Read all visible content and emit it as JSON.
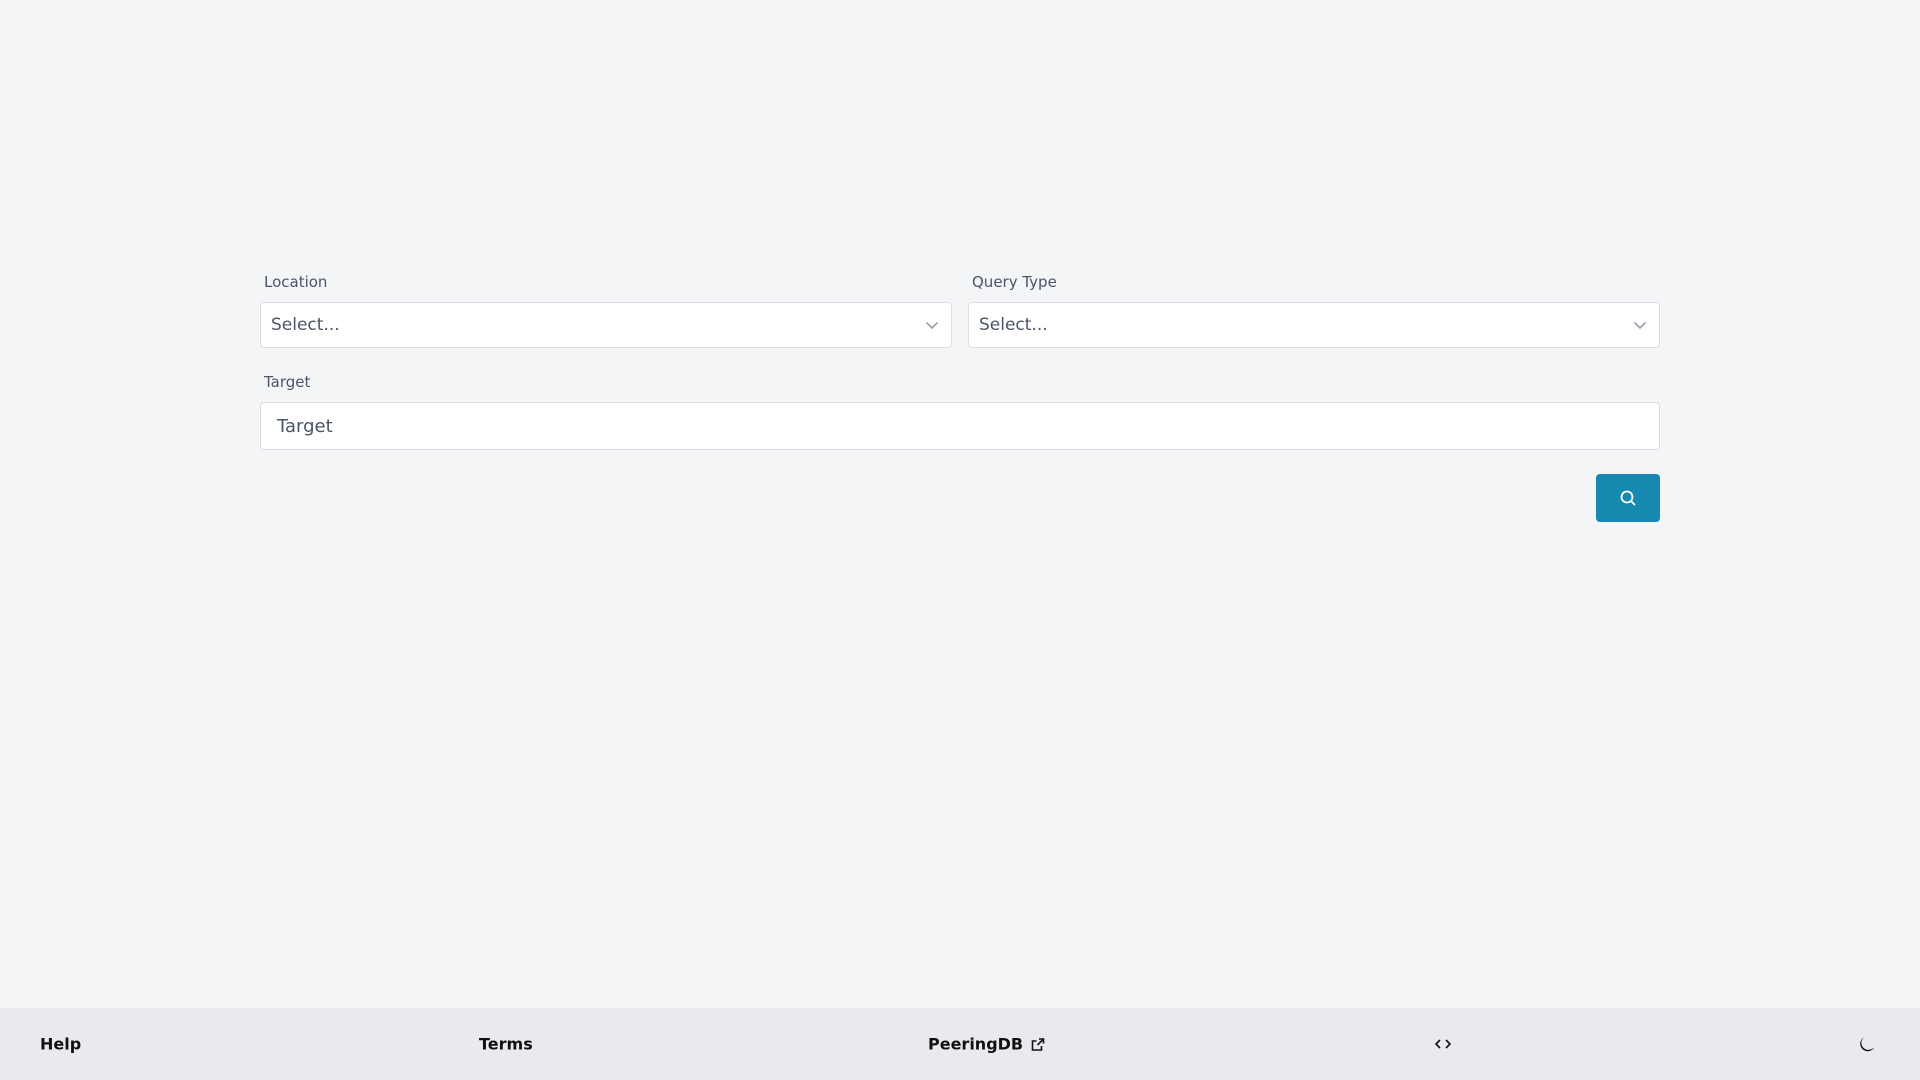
{
  "form": {
    "location": {
      "label": "Location",
      "value": "Select..."
    },
    "query_type": {
      "label": "Query Type",
      "value": "Select..."
    },
    "target": {
      "label": "Target",
      "placeholder": "Target",
      "value": ""
    },
    "submit_icon": "search-icon"
  },
  "footer": {
    "help": "Help",
    "terms": "Terms",
    "peeringdb": "PeeringDB",
    "peeringdb_icon": "external-link-icon",
    "code_icon": "code-icon",
    "theme_icon": "moon-icon"
  },
  "colors": {
    "accent": "#1689b0",
    "background": "#f4f5f7",
    "footer_background": "#e9eaed"
  }
}
